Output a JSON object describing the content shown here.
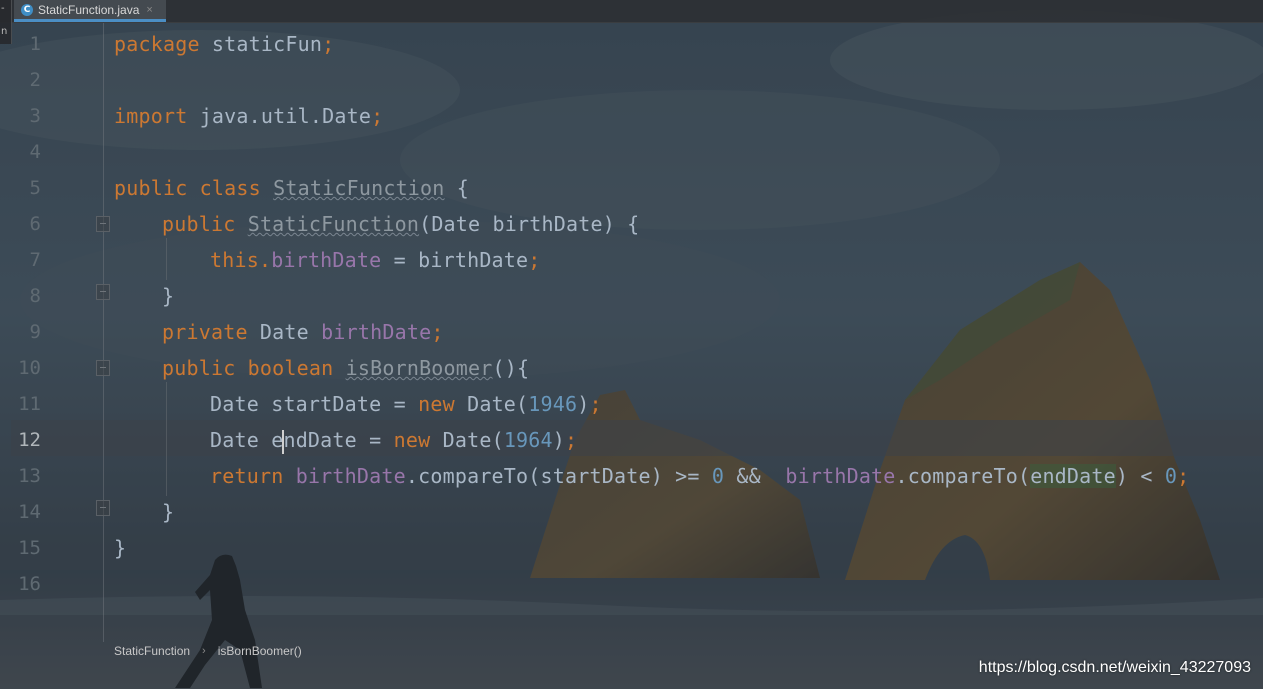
{
  "tab": {
    "file_name": "StaticFunction.java",
    "icon": "C",
    "close_glyph": "×"
  },
  "left_strip": {
    "line1": "-",
    "line2": "n"
  },
  "gutter": {
    "line_numbers": [
      "1",
      "2",
      "3",
      "4",
      "5",
      "6",
      "7",
      "8",
      "9",
      "10",
      "11",
      "12",
      "13",
      "14",
      "15",
      "16"
    ],
    "current_line": "12"
  },
  "code": {
    "l1_kw": "package",
    "l1_rest": " staticFun",
    "l1_semi": ";",
    "l3_kw": "import",
    "l3_rest": " java.util.Date",
    "l3_semi": ";",
    "l5_kw": "public class",
    "l5_cls": "StaticFunction",
    "l5_rest": " {",
    "l6_kw": "public",
    "l6_ctor": "StaticFunction",
    "l6_rest": "(Date birthDate) {",
    "l7_this": "this.",
    "l7_fld": "birthDate",
    "l7_rest": " = birthDate",
    "l7_semi": ";",
    "l8": "}",
    "l9_kw": "private",
    "l9_type": " Date ",
    "l9_fld": "birthDate",
    "l9_semi": ";",
    "l10_kw": "public boolean",
    "l10_m": "isBornBoomer",
    "l10_rest": "(){",
    "l11_a": "Date startDate = ",
    "l11_new": "new",
    "l11_b": " Date(",
    "l11_num": "1946",
    "l11_c": ")",
    "l11_semi": ";",
    "l12_a": "Date e",
    "l12_b": "ndDate = ",
    "l12_new": "new",
    "l12_c": " Date(",
    "l12_num": "1964",
    "l12_d": ")",
    "l12_semi": ";",
    "l13_ret": "return",
    "l13_f1": "birthDate",
    "l13_a": ".compareTo(startDate) >= ",
    "l13_n1": "0",
    "l13_b": " &&  ",
    "l13_f2": "birthDate",
    "l13_c": ".compareTo(",
    "l13_end": "endDate",
    "l13_d": ") < ",
    "l13_n2": "0",
    "l13_semi": ";",
    "l14": "}",
    "l15": "}"
  },
  "breadcrumb": {
    "class_name": "StaticFunction",
    "separator": "›",
    "method_name": "isBornBoomer()"
  },
  "watermark": "https://blog.csdn.net/weixin_43227093",
  "colors": {
    "keyword": "#cc7832",
    "field": "#9876aa",
    "number": "#6897bb",
    "text": "#a9b7c6",
    "tab_accent": "#4b8ec4"
  }
}
